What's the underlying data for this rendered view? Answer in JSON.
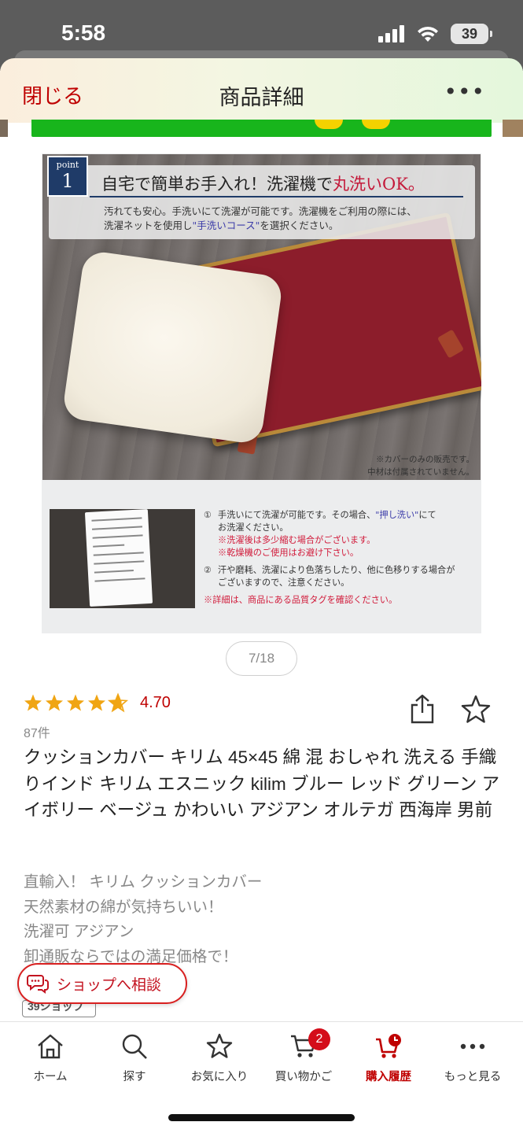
{
  "status_bar": {
    "time": "5:58",
    "battery": "39"
  },
  "header": {
    "close_label": "閉じる",
    "title": "商品詳細",
    "more_label": "•••"
  },
  "product_image": {
    "point_word": "point",
    "point_number": "1",
    "headline_main": "自宅で簡単お手入れ！洗濯機で",
    "headline_highlight": "丸洗いOK。",
    "subcopy_line1": "汚れても安心。手洗いにて洗濯が可能です。洗濯機をご利用の際には、",
    "subcopy_line2_pre": "洗濯ネットを使用し",
    "subcopy_line2_highlight": "\"手洗いコース\"",
    "subcopy_line2_post": "を選択ください。",
    "photo_note_line1": "※カバーのみの販売です。",
    "photo_note_line2": "中材は付属されていません。",
    "note1_num": "①",
    "note1_line1_pre": "手洗いにて洗濯が可能です。その場合、",
    "note1_line1_highlight": "\"押し洗い\"",
    "note1_line1_post": "にて",
    "note1_line2": "お洗濯ください。",
    "note1_warn1": "※洗濯後は多少縮む場合がございます。",
    "note1_warn2": "※乾燥機のご使用はお避け下さい。",
    "note2_num": "②",
    "note2_line1": "汗や磨耗、洗濯により色落ちしたり、他に色移りする場合が",
    "note2_line2": "ございますので、注意ください。",
    "note_footer": "※詳細は、商品にある品質タグを確認ください。"
  },
  "image_counter": "7/18",
  "rating": {
    "value": "4.70",
    "stars": 4.7,
    "review_count": "87件"
  },
  "product_title": "クッションカバー キリム 45×45 綿 混 おしゃれ 洗える 手織りインド キリム エスニック kilim ブルー レッド グリーン アイボリー ベージュ かわいい アジアン オルテガ 西海岸 男前",
  "description": [
    "直輸入！ キリム クッションカバー",
    "天然素材の綿が気持ちいい！",
    "洗濯可 アジアン",
    "卸通販ならではの満足価格で！"
  ],
  "consult_button": {
    "label": "ショップへ相談"
  },
  "shop_tag": "39ショップ",
  "bottom_nav": {
    "items": [
      {
        "label": "ホーム",
        "icon": "home-icon"
      },
      {
        "label": "探す",
        "icon": "search-icon"
      },
      {
        "label": "お気に入り",
        "icon": "star-icon"
      },
      {
        "label": "買い物かご",
        "icon": "cart-icon",
        "badge": "2"
      },
      {
        "label": "購入履歴",
        "icon": "purchase-history-icon"
      },
      {
        "label": "もっと見る",
        "icon": "more-icon"
      }
    ]
  },
  "colors": {
    "brand_red": "#bf0000",
    "star_orange": "#f0a513",
    "badge_red": "#d40d1a"
  }
}
